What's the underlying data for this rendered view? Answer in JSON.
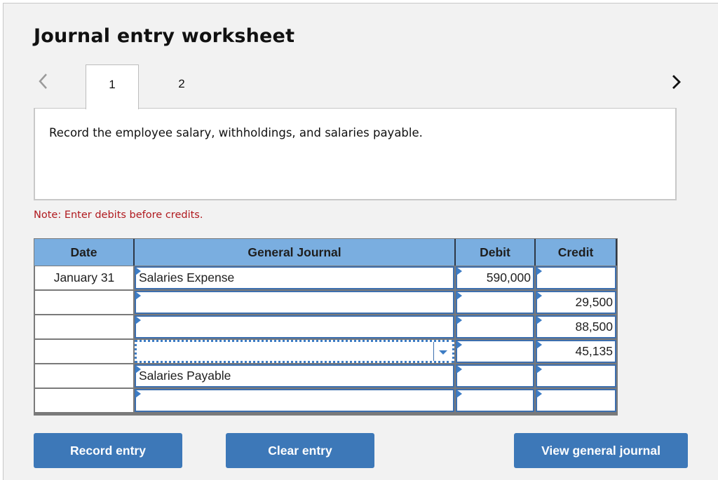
{
  "header": {
    "title": "Journal entry worksheet"
  },
  "nav": {
    "prev_icon": "chevron-left-icon",
    "next_icon": "chevron-right-icon"
  },
  "tabs": [
    {
      "label": "1",
      "active": true
    },
    {
      "label": "2",
      "active": false
    }
  ],
  "instruction": "Record the employee salary, withholdings, and salaries payable.",
  "note": "Note: Enter debits before credits.",
  "table": {
    "columns": [
      "Date",
      "General Journal",
      "Debit",
      "Credit"
    ],
    "rows": [
      {
        "date": "January 31",
        "account": "Salaries Expense",
        "debit": "590,000",
        "credit": ""
      },
      {
        "date": "",
        "account": "",
        "debit": "",
        "credit": "29,500"
      },
      {
        "date": "",
        "account": "",
        "debit": "",
        "credit": "88,500"
      },
      {
        "date": "",
        "account": "",
        "debit": "",
        "credit": "45,135",
        "account_is_dropdown": true
      },
      {
        "date": "",
        "account": "Salaries Payable",
        "debit": "",
        "credit": ""
      },
      {
        "date": "",
        "account": "",
        "debit": "",
        "credit": ""
      }
    ]
  },
  "buttons": {
    "record": "Record entry",
    "clear": "Clear entry",
    "view": "View general journal"
  },
  "colors": {
    "header_bg": "#7aaee0",
    "button_bg": "#3d78b8",
    "input_border": "#3d6fae",
    "note_text": "#b0191e"
  }
}
